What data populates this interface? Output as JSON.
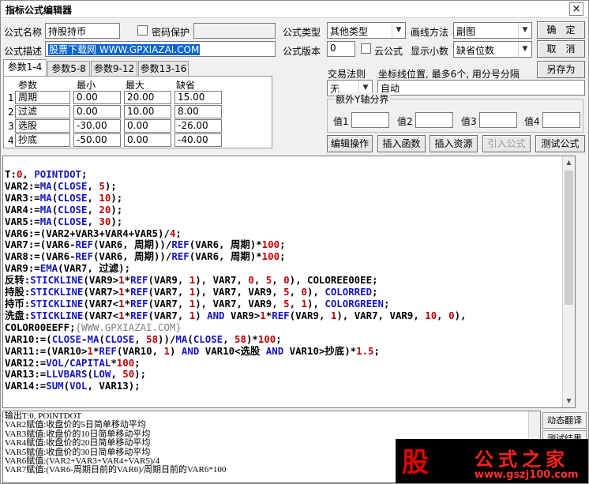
{
  "window": {
    "title": "指标公式编辑器",
    "close_glyph": "×"
  },
  "form": {
    "name_label": "公式名称",
    "name_value": "持股持币",
    "password_label": "密码保护",
    "desc_label": "公式描述",
    "desc_value": "股票下载网 WWW.GPXIAZAI.COM",
    "type_label": "公式类型",
    "type_value": "其他类型",
    "draw_label": "画线方法",
    "draw_value": "副图",
    "version_label": "公式版本",
    "version_value": "0",
    "cloud_label": "云公式",
    "decimal_label": "显示小数",
    "decimal_value": "缺省位数",
    "trade_label": "交易法则",
    "trade_value": "无",
    "coord_label": "坐标线位置, 最多6个, 用分号分隔",
    "coord_value": "自动",
    "extra_y_label": "额外Y轴分界",
    "v1": "值1",
    "v2": "值2",
    "v3": "值3",
    "v4": "值4"
  },
  "buttons": {
    "ok": "确　定",
    "cancel": "取　消",
    "save_as": "另存为",
    "edit_ops": "编辑操作",
    "insert_func": "插入函数",
    "insert_res": "插入资源",
    "import": "引入公式",
    "test": "测试公式"
  },
  "tabs": [
    "参数1-4",
    "参数5-8",
    "参数9-12",
    "参数13-16"
  ],
  "params": {
    "headers": [
      "参数",
      "最小",
      "最大",
      "缺省"
    ],
    "rows": [
      {
        "idx": "1",
        "name": "周期",
        "min": "0.00",
        "max": "20.00",
        "def": "15.00"
      },
      {
        "idx": "2",
        "name": "过滤",
        "min": "0.00",
        "max": "10.00",
        "def": "8.00"
      },
      {
        "idx": "3",
        "name": "选股",
        "min": "-30.00",
        "max": "0.00",
        "def": "-26.00"
      },
      {
        "idx": "4",
        "name": "抄底",
        "min": "-50.00",
        "max": "0.00",
        "def": "-40.00"
      }
    ]
  },
  "code_lines": [
    "T:0, POINTDOT;",
    "VAR2:=MA(CLOSE, 5);",
    "VAR3:=MA(CLOSE, 10);",
    "VAR4:=MA(CLOSE, 20);",
    "VAR5:=MA(CLOSE, 30);",
    "VAR6:=(VAR2+VAR3+VAR4+VAR5)/4;",
    "VAR7:=(VAR6-REF(VAR6, 周期))/REF(VAR6, 周期)*100;",
    "VAR8:=(VAR6-REF(VAR6, 周期))/REF(VAR6, 周期)*100;",
    "VAR9:=EMA(VAR7, 过滤);",
    "反转:STICKLINE(VAR9>1*REF(VAR9, 1), VAR7, 0, 5, 0), COLOREE00EE;",
    "持股:STICKLINE(VAR7>1*REF(VAR7, 1), VAR7, VAR9, 5, 0), COLORRED;",
    "持币:STICKLINE(VAR7<1*REF(VAR7, 1), VAR7, VAR9, 5, 1), COLORGREEN;",
    "洗盘:STICKLINE(VAR7<1*REF(VAR7, 1) AND VAR9>1*REF(VAR9, 1), VAR7, VAR9, 10, 0),",
    "COLOR00EEFF;{WWW.GPXIAZAI.COM}",
    "VAR10:=(CLOSE-MA(CLOSE, 58))/MA(CLOSE, 58)*100;",
    "VAR11:=(VAR10>1*REF(VAR10, 1) AND VAR10<选股 AND VAR10>抄底)*1.5;",
    "VAR12:=VOL/CAPITAL*100;",
    "VAR13:=LLVBARS(LOW, 50);",
    "VAR14:=SUM(VOL, VAR13);"
  ],
  "output_lines": [
    "输出T:0, POINTDOT",
    "VAR2赋值:收盘价的5日简单移动平均",
    "VAR3赋值:收盘价的10日简单移动平均",
    "VAR4赋值:收盘价的20日简单移动平均",
    "VAR5赋值:收盘价的30日简单移动平均",
    "VAR6赋值:(VAR2+VAR3+VAR4+VAR5)/4",
    "VAR7赋值:(VAR6-周期日前的VAR6)/周期日前的VAR6*100"
  ],
  "side_buttons": [
    "动态翻译",
    "测试结果"
  ],
  "watermark": {
    "glyph": "股",
    "brand": "公式之家",
    "url": "www.gszj100.com"
  },
  "colors": {
    "keyword_blue": "#1414c8",
    "number_red": "#c00000",
    "comment_grey": "#808080",
    "selection_blue": "#0a64d2"
  }
}
